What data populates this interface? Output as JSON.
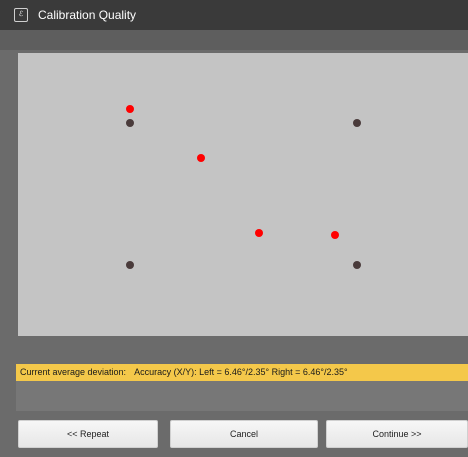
{
  "window": {
    "title": "Calibration Quality",
    "icon": "app-logo-icon",
    "icon_text": "ℰ"
  },
  "calibration": {
    "target_points_color": "#4a3b3b",
    "gaze_points_color": "#ff0000",
    "background_color": "#c4c4c4"
  },
  "status": {
    "label": "Current average deviation:",
    "text": "Accuracy (X/Y): Left = 6.46°/2.35° Right = 6.46°/2.35°",
    "background": "#f4c84a"
  },
  "buttons": {
    "repeat": "<< Repeat",
    "cancel": "Cancel",
    "continue": "Continue >>"
  }
}
